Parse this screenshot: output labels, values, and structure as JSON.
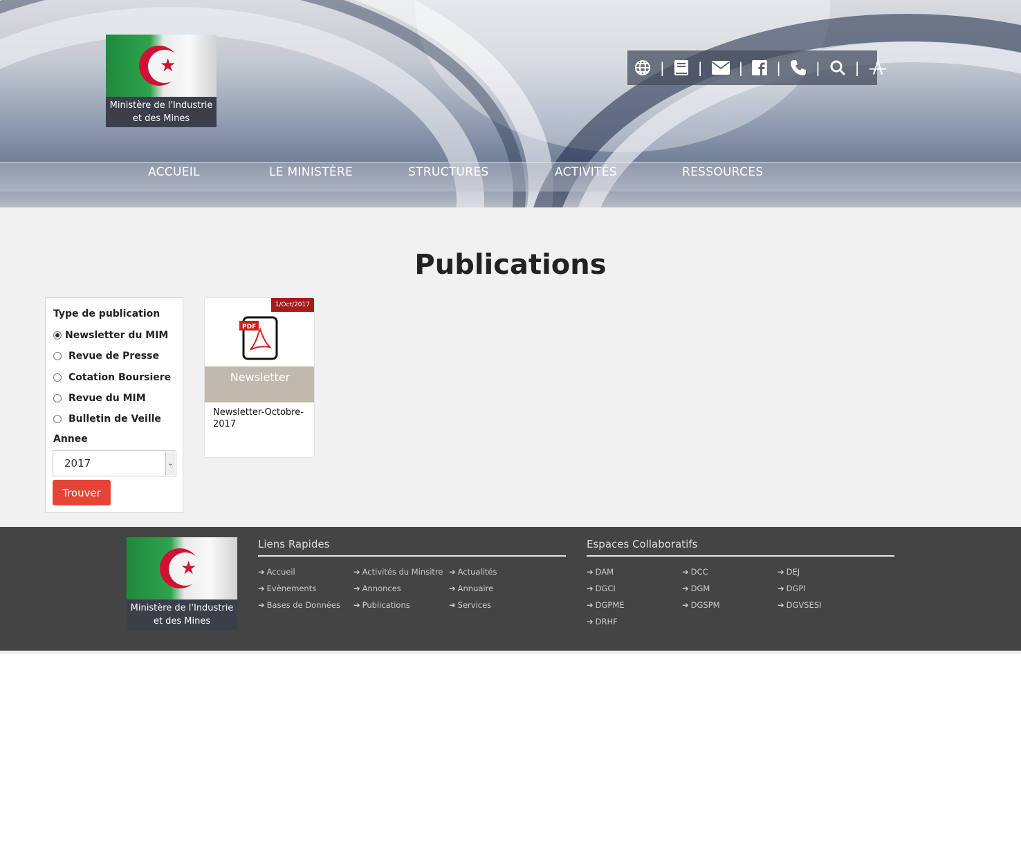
{
  "header": {
    "logo_text": "Ministère de l'Industrie et des Mines",
    "toolbar_icons": [
      "globe-icon",
      "book-icon",
      "envelope-icon",
      "facebook-icon",
      "phone-icon",
      "search-icon",
      "font-size-icon"
    ],
    "nav": [
      "ACCUEIL",
      "LE MINISTÈRE",
      "STRUCTURES",
      "ACTIVITÉS",
      "RESSOURCES"
    ]
  },
  "main": {
    "title": "Publications",
    "filter": {
      "type_label": "Type de publication",
      "types": [
        "Newsletter du MIM",
        "Revue de Presse",
        "Cotation Boursiere",
        "Revue du MIM",
        "Bulletin de Veille"
      ],
      "selected_type": "Newsletter du MIM",
      "year_label": "Annee",
      "year_value": "2017",
      "submit_label": "Trouver"
    },
    "cards": [
      {
        "date": "1/Oct/2017",
        "category": "Newsletter",
        "title": "Newsletter-Octobre-2017",
        "icon": "pdf-icon"
      }
    ]
  },
  "footer": {
    "logo_text": "Ministère de l'Industrie et des Mines",
    "quick_links_title": "Liens Rapides",
    "quick_links": [
      "Accueil",
      "Activités du Minsitre",
      "Actualités",
      "Evènements",
      "Annonces",
      "Annuaire",
      "Bases de Données",
      "Publications",
      "Services"
    ],
    "collab_title": "Espaces Collaboratifs",
    "collab_links": [
      "DAM",
      "DCC",
      "DEJ",
      "DGCI",
      "DGM",
      "DGPI",
      "DGPME",
      "DGSPM",
      "DGVSESI",
      "DRHF"
    ]
  },
  "colors": {
    "accent_red": "#e64436",
    "date_badge": "#a51c1c",
    "card_band": "#c2b9ae",
    "footer_bg": "#444444"
  }
}
